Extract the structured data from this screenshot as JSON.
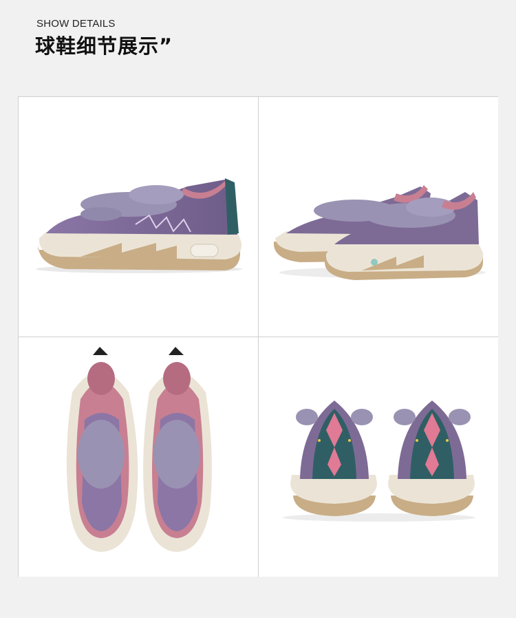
{
  "header": {
    "eyebrow": "SHOW DETAILS",
    "title": "球鞋细节展示”"
  },
  "colors": {
    "page_bg": "#f1f1f1",
    "frame": "#cfcfcf",
    "upper_purple": "#7d6b96",
    "fur_lavender": "#9a92b2",
    "lining_pink": "#c87f92",
    "midsole_cream": "#ebe4d6",
    "outsole_tan": "#c8ad86",
    "heel_teal": "#2f5f64"
  },
  "gallery": [
    {
      "view": "side-profile-icon"
    },
    {
      "view": "pair-angled-icon"
    },
    {
      "view": "top-down-icon"
    },
    {
      "view": "heel-rear-icon"
    }
  ]
}
